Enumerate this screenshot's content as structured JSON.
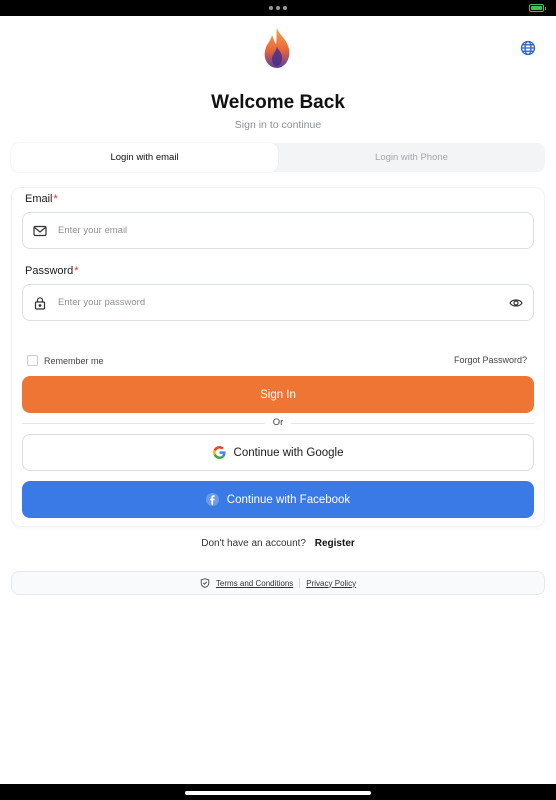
{
  "header": {
    "title": "Welcome Back",
    "subtitle": "Sign in to continue"
  },
  "tabs": [
    {
      "label": "Login with email",
      "active": true
    },
    {
      "label": "Login with Phone",
      "active": false
    }
  ],
  "form": {
    "email": {
      "label": "Email",
      "required_mark": "*",
      "placeholder": "Enter your email",
      "value": ""
    },
    "password": {
      "label": "Password",
      "required_mark": "*",
      "placeholder": "Enter your password",
      "value": ""
    },
    "remember_label": "Remember me",
    "remember_checked": false,
    "forgot_label": "Forgot Password?",
    "signin_label": "Sign In",
    "or_label": "Or",
    "google_label": "Continue with Google",
    "facebook_label": "Continue with Facebook"
  },
  "register": {
    "prompt": "Don't have an account?",
    "link": "Register"
  },
  "footer": {
    "terms": "Terms and Conditions",
    "privacy": "Privacy Policy"
  },
  "icons": {
    "logo": "flame-logo-icon",
    "language": "globe-icon",
    "email": "mail-icon",
    "password": "lock-icon",
    "toggle": "eye-icon",
    "google": "google-icon",
    "facebook": "facebook-icon",
    "footer": "shield-icon"
  },
  "colors": {
    "accent": "#ef7535",
    "facebook": "#3a7ae6",
    "required": "#e0312c",
    "logo_flame": "#f28b3b",
    "logo_base": "#5b3f9a"
  }
}
